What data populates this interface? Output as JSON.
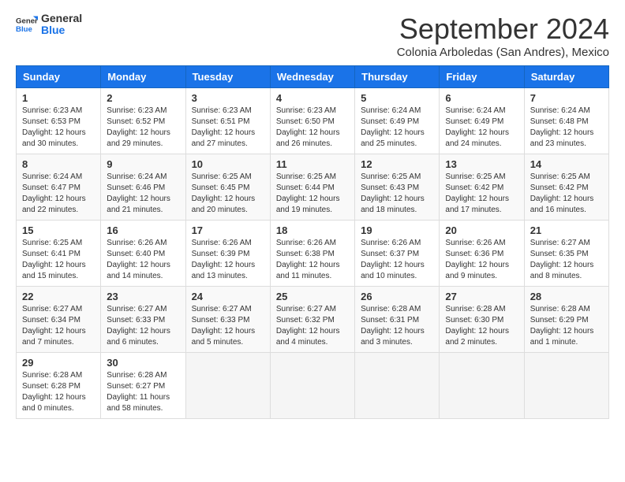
{
  "logo": {
    "text_general": "General",
    "text_blue": "Blue"
  },
  "title": "September 2024",
  "subtitle": "Colonia Arboledas (San Andres), Mexico",
  "headers": [
    "Sunday",
    "Monday",
    "Tuesday",
    "Wednesday",
    "Thursday",
    "Friday",
    "Saturday"
  ],
  "weeks": [
    [
      {
        "num": "1",
        "sunrise": "6:23 AM",
        "sunset": "6:53 PM",
        "daylight": "12 hours and 30 minutes."
      },
      {
        "num": "2",
        "sunrise": "6:23 AM",
        "sunset": "6:52 PM",
        "daylight": "12 hours and 29 minutes."
      },
      {
        "num": "3",
        "sunrise": "6:23 AM",
        "sunset": "6:51 PM",
        "daylight": "12 hours and 27 minutes."
      },
      {
        "num": "4",
        "sunrise": "6:23 AM",
        "sunset": "6:50 PM",
        "daylight": "12 hours and 26 minutes."
      },
      {
        "num": "5",
        "sunrise": "6:24 AM",
        "sunset": "6:49 PM",
        "daylight": "12 hours and 25 minutes."
      },
      {
        "num": "6",
        "sunrise": "6:24 AM",
        "sunset": "6:49 PM",
        "daylight": "12 hours and 24 minutes."
      },
      {
        "num": "7",
        "sunrise": "6:24 AM",
        "sunset": "6:48 PM",
        "daylight": "12 hours and 23 minutes."
      }
    ],
    [
      {
        "num": "8",
        "sunrise": "6:24 AM",
        "sunset": "6:47 PM",
        "daylight": "12 hours and 22 minutes."
      },
      {
        "num": "9",
        "sunrise": "6:24 AM",
        "sunset": "6:46 PM",
        "daylight": "12 hours and 21 minutes."
      },
      {
        "num": "10",
        "sunrise": "6:25 AM",
        "sunset": "6:45 PM",
        "daylight": "12 hours and 20 minutes."
      },
      {
        "num": "11",
        "sunrise": "6:25 AM",
        "sunset": "6:44 PM",
        "daylight": "12 hours and 19 minutes."
      },
      {
        "num": "12",
        "sunrise": "6:25 AM",
        "sunset": "6:43 PM",
        "daylight": "12 hours and 18 minutes."
      },
      {
        "num": "13",
        "sunrise": "6:25 AM",
        "sunset": "6:42 PM",
        "daylight": "12 hours and 17 minutes."
      },
      {
        "num": "14",
        "sunrise": "6:25 AM",
        "sunset": "6:42 PM",
        "daylight": "12 hours and 16 minutes."
      }
    ],
    [
      {
        "num": "15",
        "sunrise": "6:25 AM",
        "sunset": "6:41 PM",
        "daylight": "12 hours and 15 minutes."
      },
      {
        "num": "16",
        "sunrise": "6:26 AM",
        "sunset": "6:40 PM",
        "daylight": "12 hours and 14 minutes."
      },
      {
        "num": "17",
        "sunrise": "6:26 AM",
        "sunset": "6:39 PM",
        "daylight": "12 hours and 13 minutes."
      },
      {
        "num": "18",
        "sunrise": "6:26 AM",
        "sunset": "6:38 PM",
        "daylight": "12 hours and 11 minutes."
      },
      {
        "num": "19",
        "sunrise": "6:26 AM",
        "sunset": "6:37 PM",
        "daylight": "12 hours and 10 minutes."
      },
      {
        "num": "20",
        "sunrise": "6:26 AM",
        "sunset": "6:36 PM",
        "daylight": "12 hours and 9 minutes."
      },
      {
        "num": "21",
        "sunrise": "6:27 AM",
        "sunset": "6:35 PM",
        "daylight": "12 hours and 8 minutes."
      }
    ],
    [
      {
        "num": "22",
        "sunrise": "6:27 AM",
        "sunset": "6:34 PM",
        "daylight": "12 hours and 7 minutes."
      },
      {
        "num": "23",
        "sunrise": "6:27 AM",
        "sunset": "6:33 PM",
        "daylight": "12 hours and 6 minutes."
      },
      {
        "num": "24",
        "sunrise": "6:27 AM",
        "sunset": "6:33 PM",
        "daylight": "12 hours and 5 minutes."
      },
      {
        "num": "25",
        "sunrise": "6:27 AM",
        "sunset": "6:32 PM",
        "daylight": "12 hours and 4 minutes."
      },
      {
        "num": "26",
        "sunrise": "6:28 AM",
        "sunset": "6:31 PM",
        "daylight": "12 hours and 3 minutes."
      },
      {
        "num": "27",
        "sunrise": "6:28 AM",
        "sunset": "6:30 PM",
        "daylight": "12 hours and 2 minutes."
      },
      {
        "num": "28",
        "sunrise": "6:28 AM",
        "sunset": "6:29 PM",
        "daylight": "12 hours and 1 minute."
      }
    ],
    [
      {
        "num": "29",
        "sunrise": "6:28 AM",
        "sunset": "6:28 PM",
        "daylight": "12 hours and 0 minutes."
      },
      {
        "num": "30",
        "sunrise": "6:28 AM",
        "sunset": "6:27 PM",
        "daylight": "11 hours and 58 minutes."
      },
      null,
      null,
      null,
      null,
      null
    ]
  ]
}
